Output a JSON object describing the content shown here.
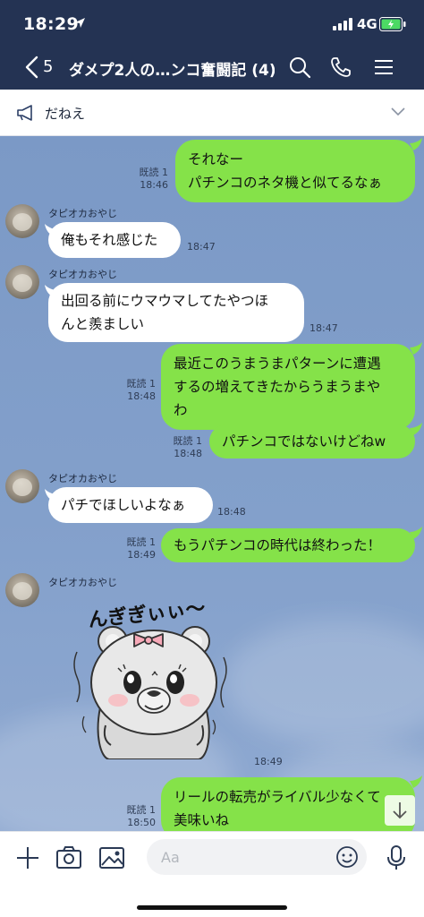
{
  "status_bar": {
    "time": "18:29",
    "network": "4G"
  },
  "header": {
    "back_count": "5",
    "title": "ダメプ2人の…ンコ奮闘記 (4)"
  },
  "announcement": {
    "text": "だねえ"
  },
  "messages": [
    {
      "dir": "out",
      "lines": [
        "それなー",
        "パチンコのネタ機と似てるなぁ"
      ],
      "read": "既読",
      "read_count": "1",
      "time": "18:46"
    },
    {
      "dir": "in",
      "sender": "タピオカおやじ",
      "lines": [
        "俺もそれ感じた"
      ],
      "time": "18:47"
    },
    {
      "dir": "in",
      "sender": "タピオカおやじ",
      "lines": [
        "出回る前にウマウマしてたやつほ",
        "んと羨ましい"
      ],
      "time": "18:47"
    },
    {
      "dir": "out",
      "lines": [
        "最近このうまうまパターンに遭遇",
        "するの増えてきたからうまうまや",
        "わ"
      ],
      "read": "既読",
      "read_count": "1",
      "time": "18:48"
    },
    {
      "dir": "out",
      "lines": [
        "パチンコではないけどねw"
      ],
      "read": "既読",
      "read_count": "1",
      "time": "18:48"
    },
    {
      "dir": "in",
      "sender": "タピオカおやじ",
      "lines": [
        "パチでほしいよなぁ"
      ],
      "time": "18:48"
    },
    {
      "dir": "out",
      "lines": [
        "もうパチンコの時代は終わった！"
      ],
      "read": "既読",
      "read_count": "1",
      "time": "18:49"
    },
    {
      "dir": "in-sticker",
      "sender": "タピオカおやじ",
      "sticker_text": "んぎぎぃぃ〜",
      "time": "18:49"
    },
    {
      "dir": "out",
      "lines": [
        "リールの転売がライバル少なくて",
        "美味いね"
      ],
      "read": "既読",
      "read_count": "1",
      "time": "18:50"
    }
  ],
  "input": {
    "placeholder": "Aa"
  },
  "icons": {
    "header": [
      "search-icon",
      "phone-icon",
      "menu-icon"
    ],
    "inputbar": [
      "plus-icon",
      "camera-icon",
      "image-icon",
      "emoji-icon",
      "microphone-icon"
    ]
  },
  "colors": {
    "header_bg": "#243353",
    "chat_bg": "#7b99c6",
    "outgoing_bubble": "#85e249",
    "incoming_bubble": "#ffffff"
  }
}
